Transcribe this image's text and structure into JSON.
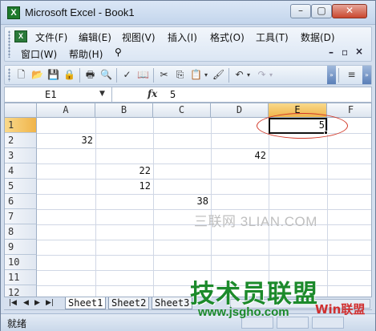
{
  "window": {
    "title": "Microsoft Excel - Book1",
    "min_glyph": "–",
    "max_glyph": "▢",
    "close_glyph": "✕"
  },
  "menubar": {
    "items": [
      {
        "label": "文件(F)"
      },
      {
        "label": "编辑(E)"
      },
      {
        "label": "视图(V)"
      },
      {
        "label": "插入(I)"
      },
      {
        "label": "格式(O)"
      },
      {
        "label": "工具(T)"
      },
      {
        "label": "数据(D)"
      },
      {
        "label": "窗口(W)"
      },
      {
        "label": "帮助(H)"
      }
    ],
    "doc_close_glyph": "×",
    "doc_restore_glyph": "▫"
  },
  "formula_bar": {
    "name_box": "E1",
    "fx": "fx",
    "value": "5"
  },
  "grid": {
    "columns": [
      "A",
      "B",
      "C",
      "D",
      "E",
      "F"
    ],
    "rows": [
      "1",
      "2",
      "3",
      "4",
      "5",
      "6",
      "7",
      "8",
      "9",
      "10",
      "11",
      "12"
    ],
    "active_cell": "E1",
    "cells": [
      {
        "ref": "E1",
        "value": "5"
      },
      {
        "ref": "A2",
        "value": "32"
      },
      {
        "ref": "D3",
        "value": "42"
      },
      {
        "ref": "B4",
        "value": "22"
      },
      {
        "ref": "B5",
        "value": "12"
      },
      {
        "ref": "C6",
        "value": "38"
      }
    ],
    "watermark": "三联网 3LIAN.COM"
  },
  "sheets": {
    "tabs": [
      "Sheet1",
      "Sheet2",
      "Sheet3"
    ],
    "active": "Sheet1"
  },
  "status": {
    "text": "就绪"
  },
  "logo": {
    "line1": "技术员联盟",
    "line2": "www.jsgho.com",
    "line3": "Win联盟"
  },
  "colors": {
    "accent": "#f0b44a",
    "annotation": "#d23a2a",
    "logo_green": "#1c8a2b"
  }
}
